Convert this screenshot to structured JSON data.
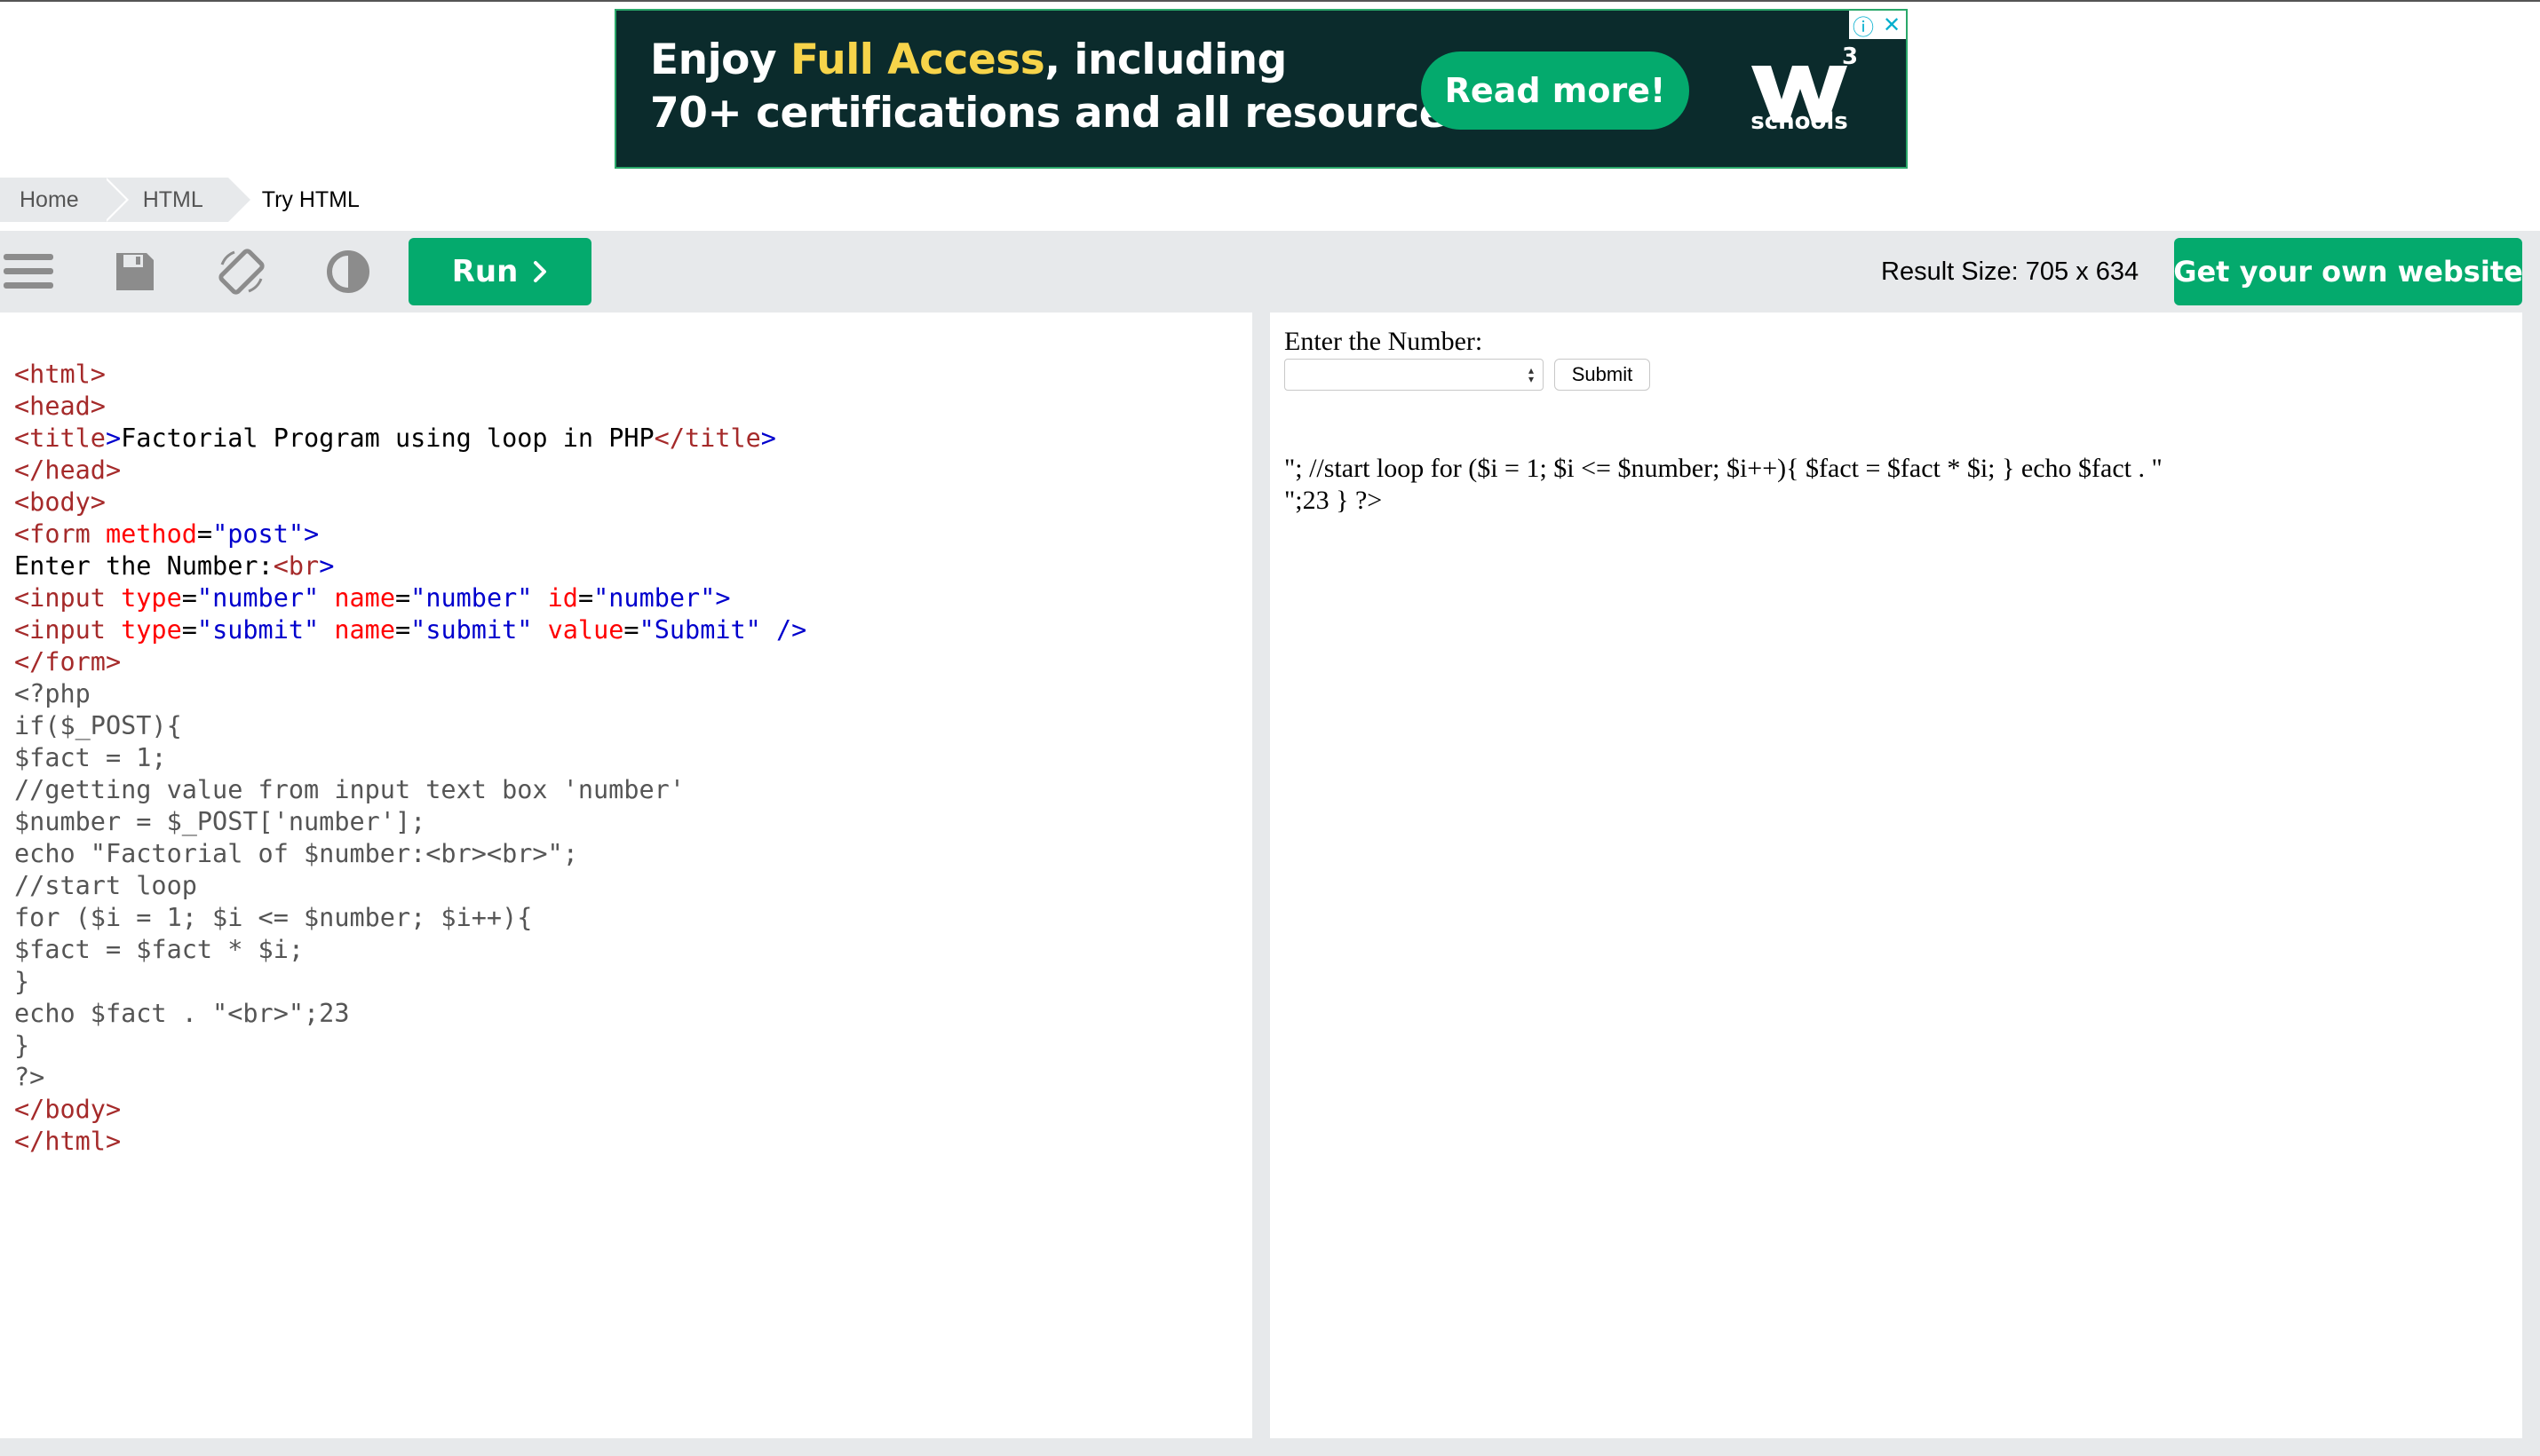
{
  "ad": {
    "line1_pre": "Enjoy ",
    "line1_highlight": "Full Access",
    "line1_post": ", including",
    "line2": "70+ certifications and all resources",
    "button": "Read more!",
    "logo_text": "schools",
    "logo_superscript": "3",
    "info_icon": "info-icon",
    "close_icon": "close-icon"
  },
  "breadcrumb": {
    "items": [
      "Home",
      "HTML",
      "Try HTML"
    ]
  },
  "toolbar": {
    "menu_icon": "menu-icon",
    "save_icon": "save-icon",
    "rotate_icon": "rotate-icon",
    "theme_icon": "contrast-icon",
    "run_label": "Run",
    "result_size_label": "Result Size: 705 x 634",
    "own_website_label": "Get your own website"
  },
  "editor": {
    "lines": [
      [
        {
          "t": "<html>",
          "c": "t"
        }
      ],
      [
        {
          "t": "<head>",
          "c": "t"
        }
      ],
      [
        {
          "t": "<title",
          "c": "t"
        },
        {
          "t": ">",
          "c": "b"
        },
        {
          "t": "Factorial Program using loop in PHP",
          "c": ""
        },
        {
          "t": "</title",
          "c": "t"
        },
        {
          "t": ">",
          "c": "b"
        }
      ],
      [
        {
          "t": "</head>",
          "c": "t"
        }
      ],
      [
        {
          "t": "<body>",
          "c": "t"
        }
      ],
      [
        {
          "t": "<form",
          "c": "t"
        },
        {
          "t": " method",
          "c": "a"
        },
        {
          "t": "=",
          "c": ""
        },
        {
          "t": "\"post\"",
          "c": "v"
        },
        {
          "t": ">",
          "c": "b"
        }
      ],
      [
        {
          "t": "Enter the Number:",
          "c": ""
        },
        {
          "t": "<br",
          "c": "t"
        },
        {
          "t": ">",
          "c": "b"
        }
      ],
      [
        {
          "t": "<input",
          "c": "t"
        },
        {
          "t": " type",
          "c": "a"
        },
        {
          "t": "=",
          "c": ""
        },
        {
          "t": "\"number\"",
          "c": "v"
        },
        {
          "t": " name",
          "c": "a"
        },
        {
          "t": "=",
          "c": ""
        },
        {
          "t": "\"number\"",
          "c": "v"
        },
        {
          "t": " id",
          "c": "a"
        },
        {
          "t": "=",
          "c": ""
        },
        {
          "t": "\"number\"",
          "c": "v"
        },
        {
          "t": ">",
          "c": "b"
        }
      ],
      [
        {
          "t": "<input",
          "c": "t"
        },
        {
          "t": " type",
          "c": "a"
        },
        {
          "t": "=",
          "c": ""
        },
        {
          "t": "\"submit\"",
          "c": "v"
        },
        {
          "t": " name",
          "c": "a"
        },
        {
          "t": "=",
          "c": ""
        },
        {
          "t": "\"submit\"",
          "c": "v"
        },
        {
          "t": " value",
          "c": "a"
        },
        {
          "t": "=",
          "c": ""
        },
        {
          "t": "\"Submit\"",
          "c": "v"
        },
        {
          "t": " />",
          "c": "b"
        }
      ],
      [
        {
          "t": "</form>",
          "c": "t"
        }
      ],
      [
        {
          "t": "<?php",
          "c": "p"
        }
      ],
      [
        {
          "t": "if($_POST){",
          "c": "p"
        }
      ],
      [
        {
          "t": "$fact = 1;",
          "c": "p"
        }
      ],
      [
        {
          "t": "//getting value from input text box 'number'",
          "c": "p"
        }
      ],
      [
        {
          "t": "$number = $_POST['number'];",
          "c": "p"
        }
      ],
      [
        {
          "t": "echo \"Factorial of $number:<br><br>\";",
          "c": "p"
        }
      ],
      [
        {
          "t": "//start loop",
          "c": "p"
        }
      ],
      [
        {
          "t": "for ($i = 1; $i <= $number; $i++){",
          "c": "p"
        }
      ],
      [
        {
          "t": "$fact = $fact * $i;",
          "c": "p"
        }
      ],
      [
        {
          "t": "}",
          "c": "p"
        }
      ],
      [
        {
          "t": "echo $fact . \"<br>\";23",
          "c": "p"
        }
      ],
      [
        {
          "t": "}",
          "c": "p"
        }
      ],
      [
        {
          "t": "?>",
          "c": "p"
        }
      ],
      [
        {
          "t": "</body>",
          "c": "t"
        }
      ],
      [
        {
          "t": "</html>",
          "c": "t"
        }
      ]
    ]
  },
  "result": {
    "label": "Enter the Number:",
    "input_value": "",
    "submit_label": "Submit",
    "output_line1": "\"; //start loop for ($i = 1; $i <= $number; $i++){ $fact = $fact * $i; } echo $fact . \"",
    "output_line2": "\";23 } ?>"
  },
  "colors": {
    "brand_green": "#04aa6d",
    "toolbar_bg": "#e7e9eb",
    "tag": "#a52a2a",
    "attr": "#ff0000",
    "value": "#0000cd",
    "php": "#555555"
  }
}
